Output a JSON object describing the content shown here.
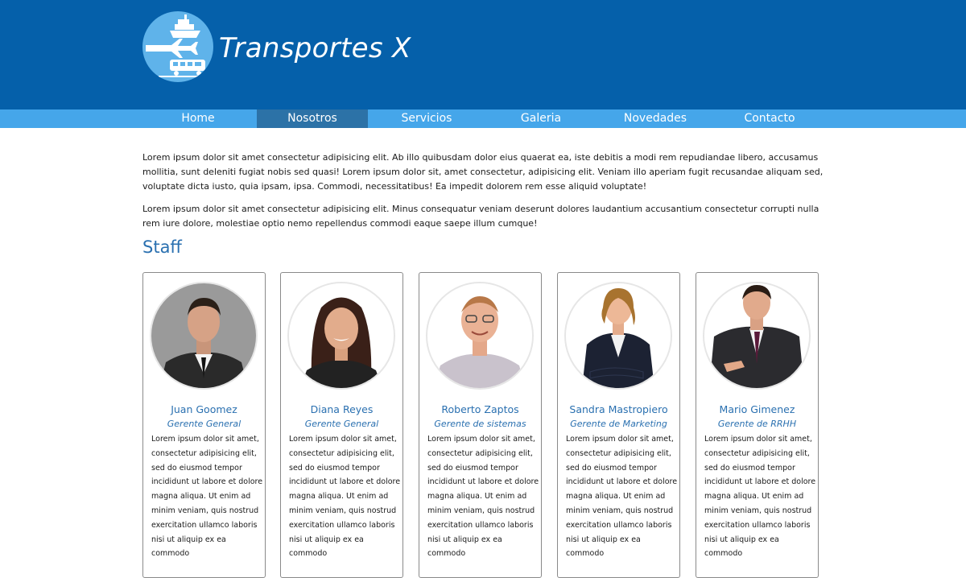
{
  "site": {
    "title": "Transportes X",
    "logo_icon": "transport-logo-icon",
    "colors": {
      "header": "#0560aa",
      "nav": "#45a6ea",
      "nav_active": "#2c72a7",
      "accent_text": "#2a70b0"
    }
  },
  "nav": {
    "items": [
      {
        "label": "Home"
      },
      {
        "label": "Nosotros",
        "active": true
      },
      {
        "label": "Servicios"
      },
      {
        "label": "Galeria"
      },
      {
        "label": "Novedades"
      },
      {
        "label": "Contacto"
      }
    ]
  },
  "intro": {
    "paragraph1": "Lorem ipsum dolor sit amet consectetur adipisicing elit. Ab illo quibusdam dolor eius quaerat ea, iste debitis a modi rem repudiandae libero, accusamus mollitia, sunt deleniti fugiat nobis sed quasi! Lorem ipsum dolor sit, amet consectetur, adipisicing elit. Veniam illo aperiam fugit recusandae aliquam sed, voluptate dicta iusto, quia ipsam, ipsa. Commodi, necessitatibus! Ea impedit dolorem rem esse aliquid voluptate!",
    "paragraph2": "Lorem ipsum dolor sit amet consectetur adipisicing elit. Minus consequatur veniam deserunt dolores laudantium accusantium consectetur corrupti nulla rem iure dolore, molestiae optio nemo repellendus commodi eaque saepe illum cumque!"
  },
  "staff": {
    "heading": "Staff",
    "members": [
      {
        "name": "Juan Goomez",
        "role": "Gerente General",
        "bio": "Lorem ipsum dolor sit amet, consectetur adipisicing elit, sed do eiusmod tempor incididunt ut labore et dolore magna aliqua. Ut enim ad minim veniam, quis nostrud exercitation ullamco laboris nisi ut aliquip ex ea commodo"
      },
      {
        "name": "Diana Reyes",
        "role": "Gerente General",
        "bio": "Lorem ipsum dolor sit amet, consectetur adipisicing elit, sed do eiusmod tempor incididunt ut labore et dolore magna aliqua. Ut enim ad minim veniam, quis nostrud exercitation ullamco laboris nisi ut aliquip ex ea commodo"
      },
      {
        "name": "Roberto Zaptos",
        "role": "Gerente de sistemas",
        "bio": "Lorem ipsum dolor sit amet, consectetur adipisicing elit, sed do eiusmod tempor incididunt ut labore et dolore magna aliqua. Ut enim ad minim veniam, quis nostrud exercitation ullamco laboris nisi ut aliquip ex ea commodo"
      },
      {
        "name": "Sandra Mastropiero",
        "role": "Gerente de Marketing",
        "bio": "Lorem ipsum dolor sit amet, consectetur adipisicing elit, sed do eiusmod tempor incididunt ut labore et dolore magna aliqua. Ut enim ad minim veniam, quis nostrud exercitation ullamco laboris nisi ut aliquip ex ea commodo"
      },
      {
        "name": "Mario Gimenez",
        "role": "Gerente de RRHH",
        "bio": "Lorem ipsum dolor sit amet, consectetur adipisicing elit, sed do eiusmod tempor incididunt ut labore et dolore magna aliqua. Ut enim ad minim veniam, quis nostrud exercitation ullamco laboris nisi ut aliquip ex ea commodo"
      }
    ]
  }
}
